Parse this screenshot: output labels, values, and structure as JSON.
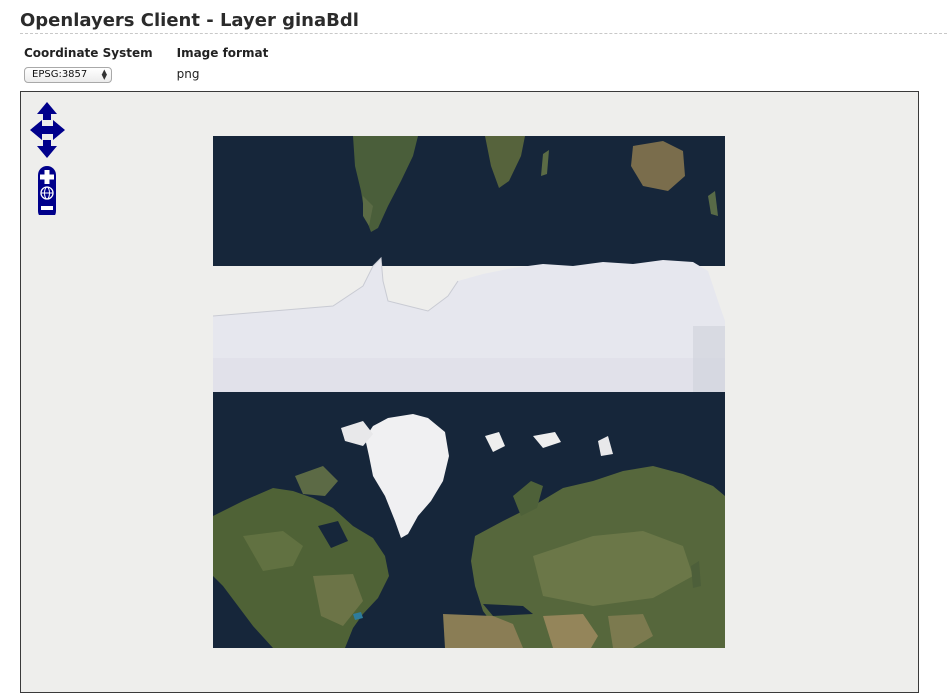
{
  "header": {
    "title": "Openlayers Client - Layer ginaBdl"
  },
  "options": {
    "coordinate_system_label": "Coordinate System",
    "image_format_label": "Image format",
    "coordinate_system_value": "EPSG:3857",
    "image_format_value": "png"
  },
  "map": {
    "background_color": "#eeeeec",
    "controls_color": "#00008b",
    "controls": [
      "pan-north",
      "pan-west",
      "pan-east",
      "pan-south",
      "zoom-in",
      "zoom-world",
      "zoom-out"
    ],
    "image_description": "satellite world map tile with duplicated rows"
  }
}
